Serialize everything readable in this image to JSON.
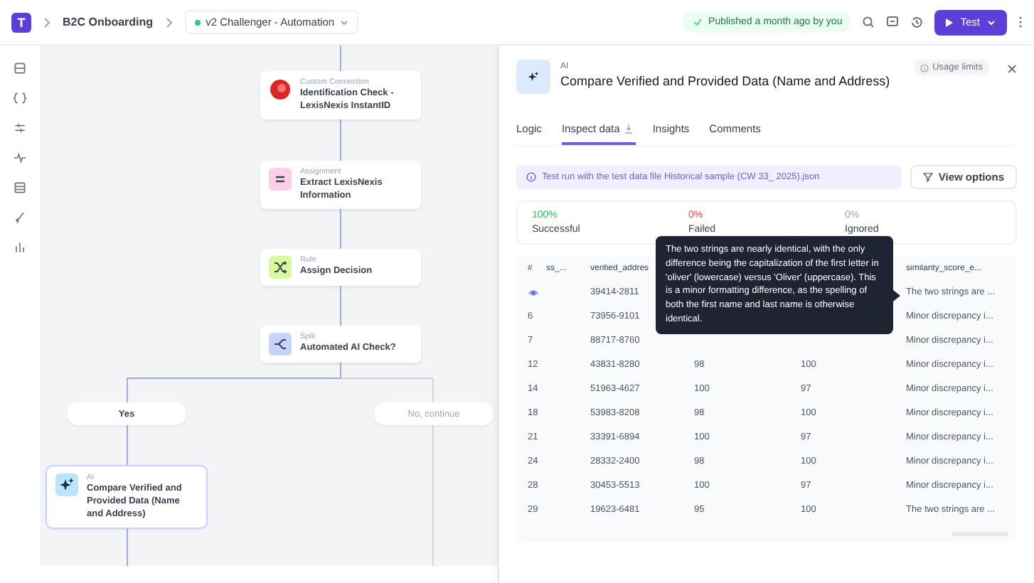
{
  "topbar": {
    "logo": "T",
    "breadcrumb": "B2C Onboarding",
    "version": {
      "label": "v2 Challenger - Automation",
      "color": "#34c38f"
    },
    "published": "Published a month ago by you",
    "test_button": "Test"
  },
  "sidebar": {
    "items": [
      {
        "kind": "database"
      },
      {
        "kind": "braces"
      },
      {
        "kind": "sliders"
      },
      {
        "kind": "pulse"
      },
      {
        "kind": "table"
      },
      {
        "kind": "brush"
      },
      {
        "kind": "chart"
      }
    ]
  },
  "flow": {
    "nodes": [
      {
        "kind": "connection",
        "type": "Custom Connection",
        "title": "Identification Check - LexisNexis InstantID",
        "selected": false
      },
      {
        "kind": "assignment",
        "type": "Assignment",
        "title": "Extract LexisNexis Information",
        "selected": false
      },
      {
        "kind": "rule",
        "type": "Rule",
        "title": "Assign Decision",
        "selected": false
      },
      {
        "kind": "split",
        "type": "Split",
        "title": "Automated AI Check?",
        "selected": false
      },
      {
        "kind": "ai",
        "type": "AI",
        "title": "Compare Verified and Provided Data (Name and Address)",
        "selected": true
      }
    ],
    "branches": [
      {
        "label": "Yes",
        "active": true
      },
      {
        "label": "No, continue",
        "active": false
      }
    ]
  },
  "panel": {
    "type": "AI",
    "title": "Compare Verified and Provided Data (Name and Address)",
    "usage_limits": "Usage limits",
    "tabs": [
      {
        "label": "Logic",
        "selected": false
      },
      {
        "label": "Inspect data",
        "selected": true
      },
      {
        "label": "Insights",
        "selected": false
      },
      {
        "label": "Comments",
        "selected": false
      }
    ],
    "banner": "Test run with the test data file Historical sample (CW 33_ 2025).json",
    "view_options": "View options",
    "stats": [
      {
        "value": "100%",
        "label": "Successful",
        "color": "#22c55e"
      },
      {
        "value": "0%",
        "label": "Failed",
        "color": "#ef4444"
      },
      {
        "value": "0%",
        "label": "Ignored",
        "color": "#9ca3af"
      }
    ],
    "table": {
      "columns": [
        "#",
        "ss_...",
        "verified_addres",
        "",
        "",
        "similarity_score_e..."
      ],
      "rows": [
        {
          "kind": "viewed",
          "cells": [
            "",
            "",
            "39414-2811",
            "",
            "",
            "The two strings are ..."
          ]
        },
        {
          "kind": "plain",
          "cells": [
            "6",
            "",
            "73956-9101",
            "",
            "",
            "Minor discrepancy i..."
          ]
        },
        {
          "kind": "plain",
          "cells": [
            "7",
            "",
            "88717-8760",
            "",
            "",
            "Minor discrepancy i..."
          ]
        },
        {
          "kind": "plain",
          "cells": [
            "12",
            "",
            "43831-8280",
            "98",
            "100",
            "Minor discrepancy i..."
          ]
        },
        {
          "kind": "plain",
          "cells": [
            "14",
            "",
            "51963-4627",
            "100",
            "97",
            "Minor discrepancy i..."
          ]
        },
        {
          "kind": "plain",
          "cells": [
            "18",
            "",
            "53983-8208",
            "98",
            "100",
            "Minor discrepancy i..."
          ]
        },
        {
          "kind": "plain",
          "cells": [
            "21",
            "",
            "33391-6894",
            "100",
            "97",
            "Minor discrepancy i..."
          ]
        },
        {
          "kind": "plain",
          "cells": [
            "24",
            "",
            "28332-2400",
            "98",
            "100",
            "Minor discrepancy i..."
          ]
        },
        {
          "kind": "plain",
          "cells": [
            "28",
            "",
            "30453-5513",
            "100",
            "97",
            "Minor discrepancy i..."
          ]
        },
        {
          "kind": "plain",
          "cells": [
            "29",
            "",
            "19623-6481",
            "95",
            "100",
            "The two strings are ..."
          ]
        }
      ]
    },
    "tooltip": "The two strings are nearly identical, with the only difference being the capitalization of the first letter in 'oliver' (lowercase) versus 'Oliver' (uppercase). This is a minor formatting difference, as the spelling of both the first name and last name is otherwise identical."
  }
}
